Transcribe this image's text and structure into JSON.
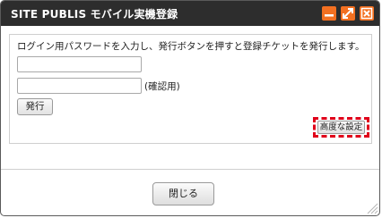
{
  "window": {
    "title": "SITE PUBLIS モバイル実機登録",
    "minimize_icon": "minimize-icon",
    "maximize_icon": "maximize-icon",
    "close_icon": "close-icon",
    "accent_color": "#f37021"
  },
  "form": {
    "instruction": "ログイン用パスワードを入力し、発行ボタンを押すと登録チケットを発行します。",
    "password_value": "",
    "confirm_value": "",
    "confirm_label": "(確認用)",
    "issue_button": "発行",
    "advanced_button": "高度な設定",
    "highlight_color": "#e0001a"
  },
  "footer": {
    "close_button": "閉じる"
  }
}
